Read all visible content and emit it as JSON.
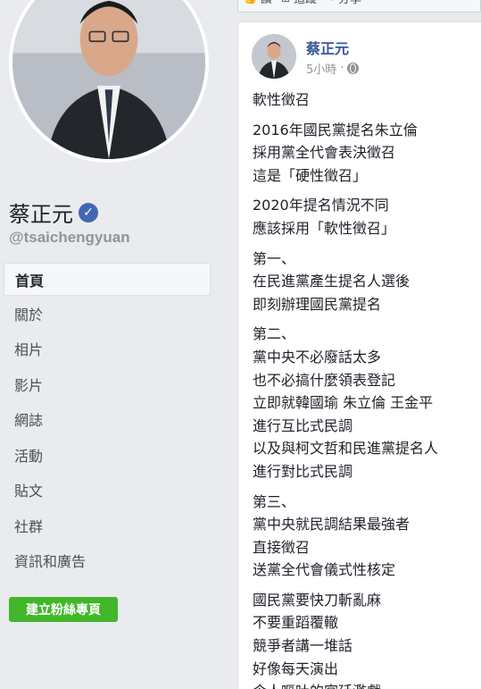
{
  "sidebar": {
    "page_name": "蔡正元",
    "verified_icon": "verified-check-icon",
    "handle": "@tsaichengyuan",
    "nav": [
      {
        "label": "首頁",
        "active": true
      },
      {
        "label": "關於",
        "active": false
      },
      {
        "label": "相片",
        "active": false
      },
      {
        "label": "影片",
        "active": false
      },
      {
        "label": "網誌",
        "active": false
      },
      {
        "label": "活動",
        "active": false
      },
      {
        "label": "貼文",
        "active": false
      },
      {
        "label": "社群",
        "active": false
      },
      {
        "label": "資訊和廣告",
        "active": false
      }
    ],
    "create_button": "建立粉絲專頁"
  },
  "actionbar": {
    "btn1": "讚",
    "btn2": "追蹤",
    "btn3": "分享"
  },
  "post": {
    "author": "蔡正元",
    "time": "5小時",
    "privacy_icon": "globe-icon",
    "paragraphs": [
      [
        "軟性徵召"
      ],
      [
        "2016年國民黨提名朱立倫",
        "採用黨全代會表決徵召",
        "這是「硬性徵召」"
      ],
      [
        "2020年提名情況不同",
        "應該採用「軟性徵召」"
      ],
      [
        "第一、",
        "在民進黨產生提名人選後",
        "即刻辦理國民黨提名"
      ],
      [
        "第二、",
        "黨中央不必廢話太多",
        "也不必搞什麼領表登記",
        "立即就韓國瑜 朱立倫 王金平",
        "進行互比式民調",
        "以及與柯文哲和民進黨提名人",
        "進行對比式民調"
      ],
      [
        "第三、",
        "黨中央就民調結果最強者",
        "直接徵召",
        "送黨全代會儀式性核定"
      ],
      [
        "國民黨要快刀斬亂麻",
        "不要重蹈覆轍",
        "競爭者講一堆話",
        "好像每天演出",
        "令人嘔吐的宮廷濫戲"
      ]
    ]
  },
  "colors": {
    "background": "#e9ebee",
    "link": "#385898",
    "verified": "#4267b2",
    "create_button": "#42b72a"
  }
}
